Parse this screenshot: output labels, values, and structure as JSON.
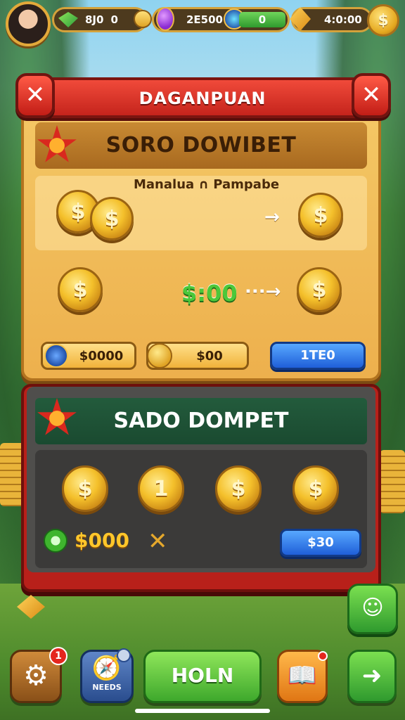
{
  "hud": {
    "coins_value": "8J0",
    "coins_extra": "0",
    "energy_value": "2E500",
    "progress_value": "0",
    "gold_value": "4:0:00",
    "coin_symbol": "$"
  },
  "dialog": {
    "title": "DAGANPUAN",
    "close_label": "✕"
  },
  "section1": {
    "title": "SORO DOWIBET",
    "subtitle": "Manalua ∩ Pampabe",
    "coin_symbol": "$",
    "arrow_label": "→",
    "dashed_arrow_label": "···→",
    "exchange_amount": "$:00",
    "field1_value": "$0000",
    "field2_value": "$00",
    "button_label": "1TE0"
  },
  "section2": {
    "title": "SADO DOMPET",
    "coins": [
      "$",
      "1",
      "$",
      "$"
    ],
    "amount": "$000",
    "cross_label": "✕",
    "button_label": "$30"
  },
  "bottom_bar": {
    "settings_badge": "1",
    "compass_label": "NEEDS",
    "hold_label": "HOLN",
    "side_face_label": "☺"
  },
  "colors": {
    "banner_red": "#d52a20",
    "panel_gold": "#f1bd5c",
    "section2_green": "#1f5235",
    "accent_blue": "#2f77e8",
    "accent_green": "#4cc83a"
  }
}
